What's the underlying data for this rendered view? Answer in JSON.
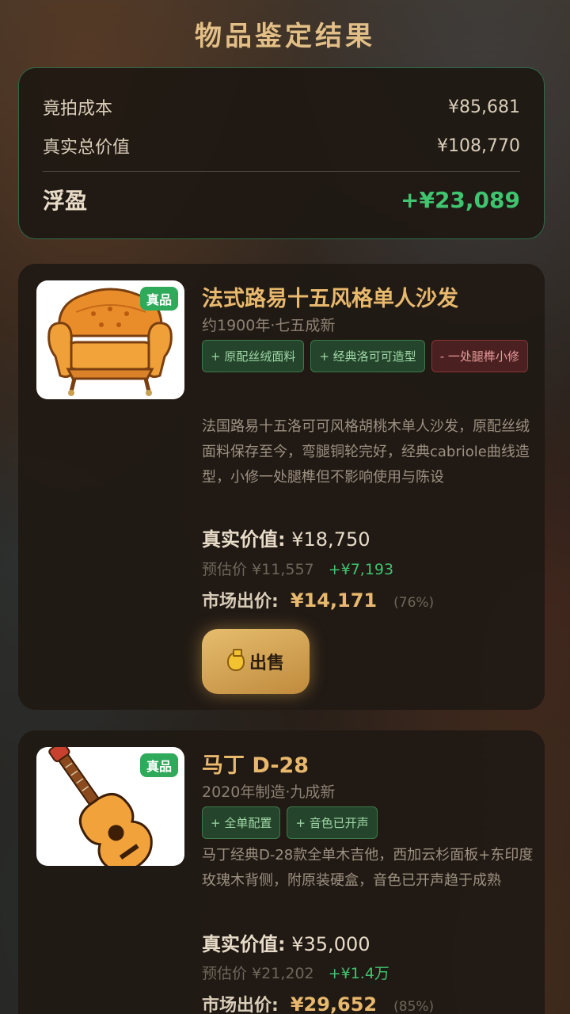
{
  "page_title": "物品鉴定结果",
  "summary": {
    "cost_label": "竟拍成本",
    "cost_value": "¥85,681",
    "total_label": "真实总价值",
    "total_value": "¥108,770",
    "profit_label": "浮盈",
    "profit_value": "+¥23,089"
  },
  "items": [
    {
      "name": "法式路易十五风格单人沙发",
      "subtitle": "约1900年·七五成新",
      "badge": "真品",
      "image_icon": "armchair-icon",
      "tags_good": [
        "+ 原配丝绒面料",
        "+ 经典洛可可造型"
      ],
      "tags_bad": [
        "- 一处腿榫小修"
      ],
      "description": "法国路易十五洛可可风格胡桃木单人沙发，原配丝绒面料保存至今，弯腿铜轮完好，经典cabriole曲线造型，小修一处腿榫但不影响使用与陈设",
      "real_label": "真实价值:",
      "real_value": "¥18,750",
      "estimate_label": "预估价",
      "estimate_value": "¥11,557",
      "estimate_gain": "+¥7,193",
      "market_label": "市场出价:",
      "market_value": "¥14,171",
      "market_pct": "(76%)",
      "sell_label": "出售"
    },
    {
      "name": "马丁 D-28",
      "subtitle": "2020年制造·九成新",
      "badge": "真品",
      "image_icon": "acoustic-guitar-icon",
      "tags_good": [
        "+ 全单配置",
        "+ 音色已开声"
      ],
      "description": "马丁经典D-28款全单木吉他，西加云杉面板+东印度玫瑰木背侧，附原装硬盒，音色已开声趋于成熟",
      "real_label": "真实价值:",
      "real_value": "¥35,000",
      "estimate_label": "预估价",
      "estimate_value": "¥21,202",
      "estimate_gain": "+¥1.4万",
      "market_label": "市场出价:",
      "market_value": "¥29,652",
      "market_pct": "(85%)"
    }
  ],
  "colors": {
    "accent_gold": "#e8b86d",
    "profit_green": "#3fc46f",
    "badge_green": "#2faa5a",
    "tag_bad_red": "#e79a9a"
  }
}
